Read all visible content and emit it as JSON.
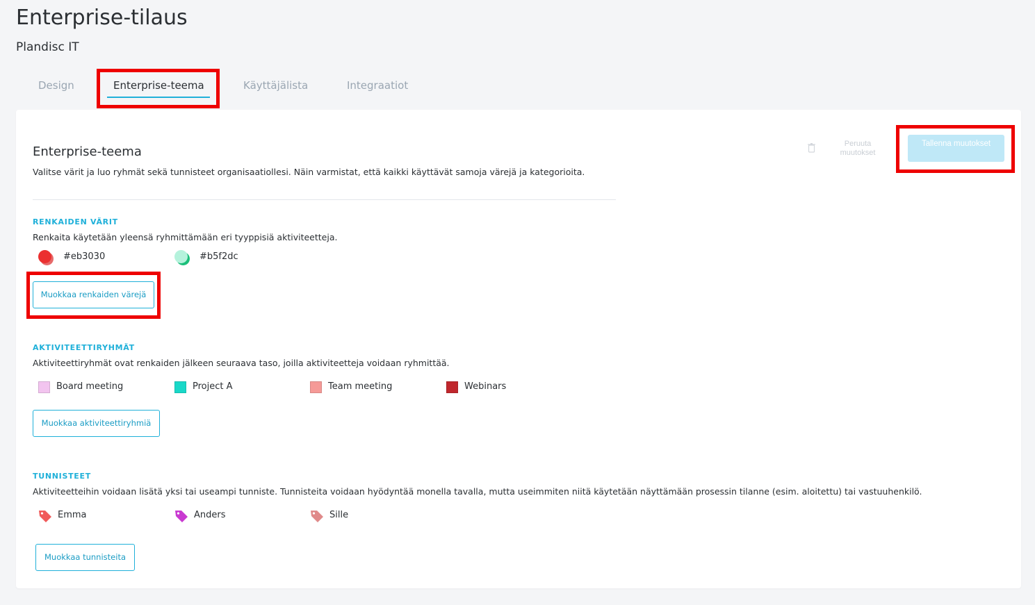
{
  "page": {
    "title": "Enterprise-tilaus",
    "organization": "Plandisc IT"
  },
  "tabs": [
    {
      "label": "Design",
      "active": false
    },
    {
      "label": "Enterprise-teema",
      "active": true
    },
    {
      "label": "Käyttäjälista",
      "active": false
    },
    {
      "label": "Integraatiot",
      "active": false
    }
  ],
  "section": {
    "title": "Enterprise-teema",
    "description": "Valitse värit ja luo ryhmät sekä tunnisteet organisaatiollesi. Näin varmistat, että kaikki käyttävät samoja värejä ja kategorioita."
  },
  "toolbar": {
    "undo_label": "Peruuta muutokset",
    "save_label": "Tallenna muutokset"
  },
  "ring_colors": {
    "heading": "RENKAIDEN VÄRIT",
    "description": "Renkaita käytetään yleensä ryhmittämään eri tyyppisiä aktiviteetteja.",
    "items": [
      {
        "label": "#eb3030",
        "color": "#eb3030"
      },
      {
        "label": "#b5f2dc",
        "color": "#b5f2dc"
      }
    ],
    "edit_label": "Muokkaa renkaiden värejä"
  },
  "activity_groups": {
    "heading": "AKTIVITEETTIRYHMÄT",
    "description": "Aktiviteettiryhmät ovat renkaiden jälkeen seuraava taso, joilla aktiviteetteja voidaan ryhmittää.",
    "items": [
      {
        "label": "Board meeting",
        "color": "#f2c4ef"
      },
      {
        "label": "Project A",
        "color": "#19d8c8"
      },
      {
        "label": "Team meeting",
        "color": "#f59a97"
      },
      {
        "label": "Webinars",
        "color": "#c0272d"
      }
    ],
    "edit_label": "Muokkaa aktiviteettiryhmiä"
  },
  "tags": {
    "heading": "TUNNISTEET",
    "description": "Aktiviteetteihin voidaan lisätä yksi tai useampi tunniste. Tunnisteita voidaan hyödyntää monella tavalla, mutta useimmiten niitä käytetään näyttämään prosessin tilanne (esim. aloitettu) tai vastuuhenkilö.",
    "items": [
      {
        "label": "Emma",
        "color": "#f05a5a",
        "icon": "tag-icon"
      },
      {
        "label": "Anders",
        "color": "#c93ad1",
        "icon": "tag-icon"
      },
      {
        "label": "Sille",
        "color": "#e08a8a",
        "icon": "tag-icon"
      }
    ],
    "edit_label": "Muokkaa tunnisteita"
  },
  "colors": {
    "accent": "#1fb0d9",
    "highlight": "#ee0000"
  }
}
